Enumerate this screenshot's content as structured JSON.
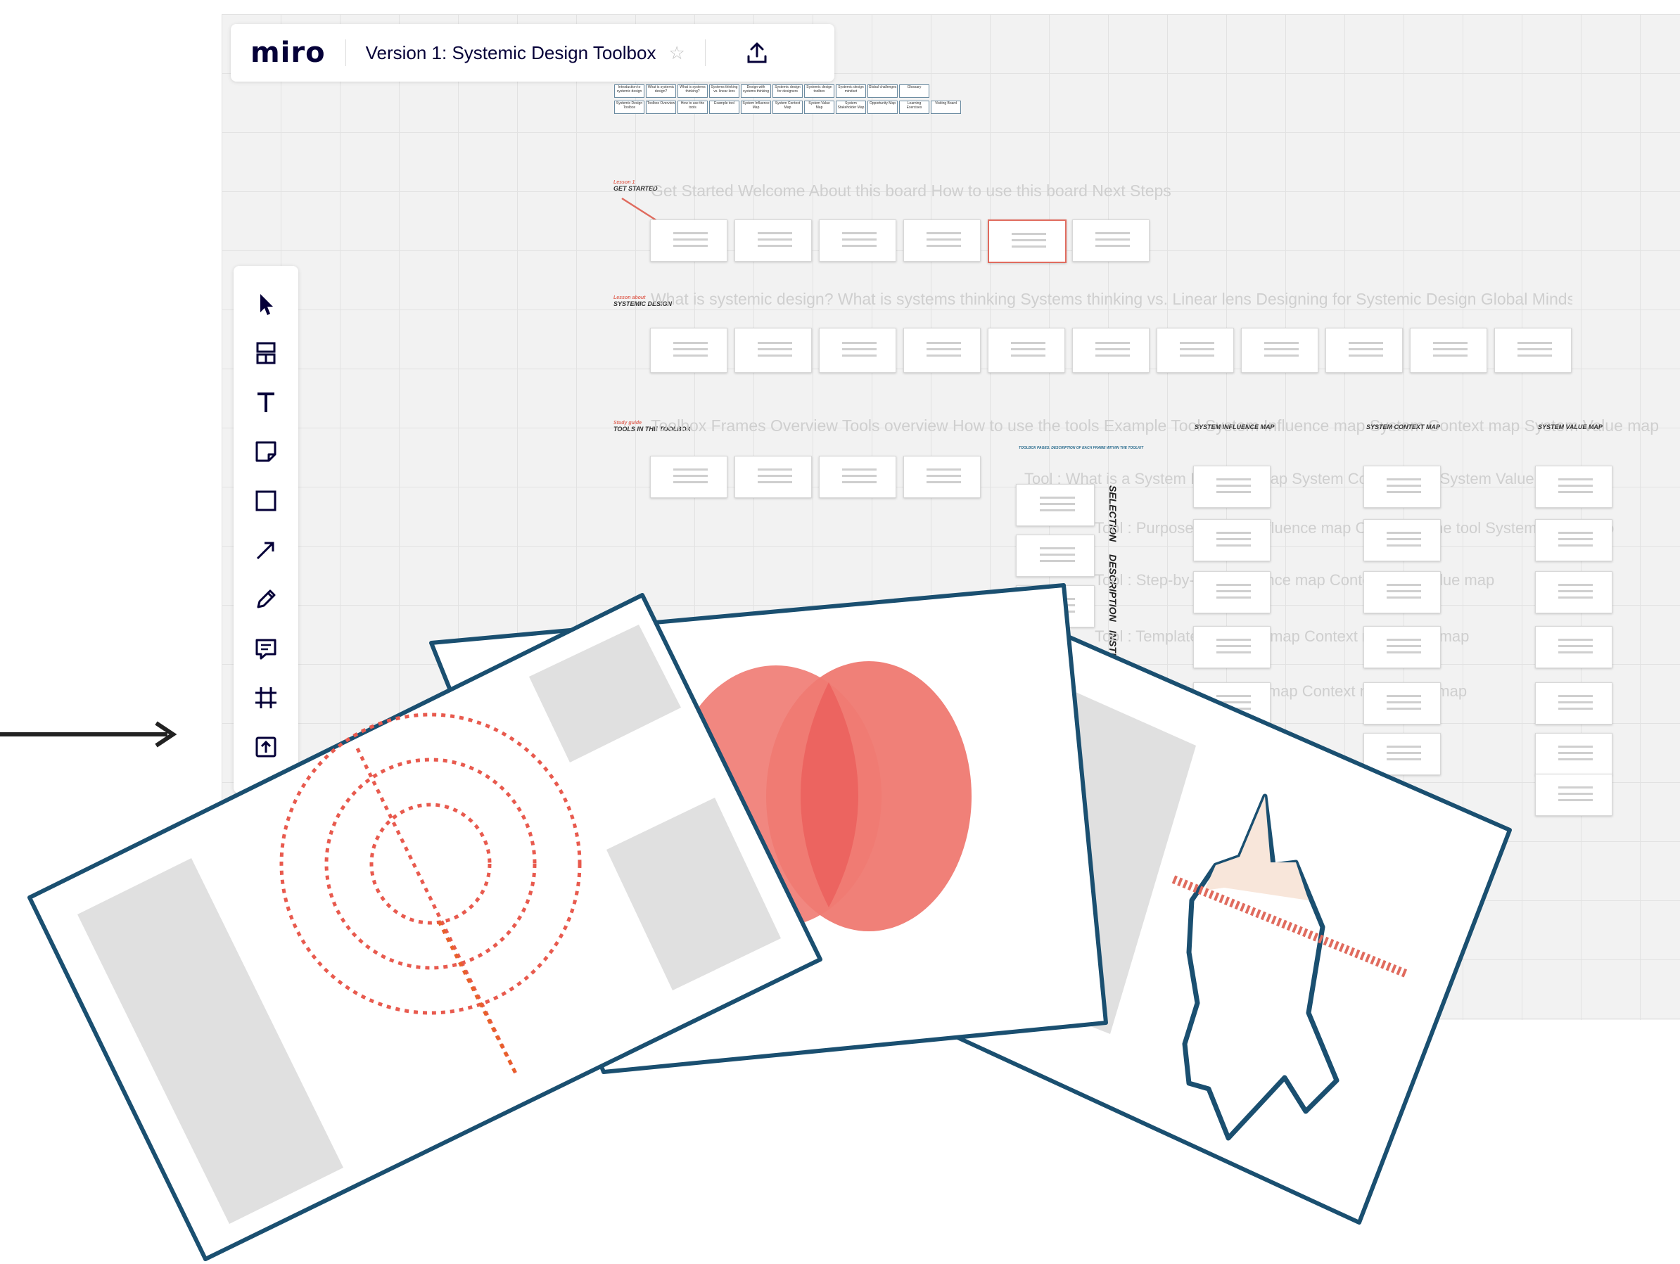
{
  "app": {
    "logo": "miro",
    "board_title": "Version 1: Systemic Design Toolbox"
  },
  "icons": {
    "star": "star-icon",
    "upload": "upload-icon",
    "tools": [
      "cursor-icon",
      "templates-icon",
      "text-icon",
      "sticky-note-icon",
      "rectangle-icon",
      "arrow-icon",
      "pen-icon",
      "comment-icon",
      "frame-icon",
      "upload-tool-icon"
    ]
  },
  "colors": {
    "accent": "#e06b5e",
    "brand": "#050038",
    "card_border": "#1a4f70",
    "coral": "#f07a70"
  },
  "nav_table": {
    "row1": [
      "Introduction to systemic design",
      "What is systemic design?",
      "What is systems thinking?",
      "Systems thinking vs. linear lens",
      "Design with systems thinking",
      "Systemic design for designers",
      "Systemic design toolbox",
      "Systemic design mindset",
      "Global challenges",
      "Glossary"
    ],
    "row2": [
      "Systemic Design Toolbox",
      "Toolbox Overview",
      "How to use the tools",
      "Example tool",
      "System Influence Map",
      "System Context Map",
      "System Value Map",
      "System Stakeholder Map",
      "Opportunity Map",
      "Learning Exercises",
      "Visiting Board"
    ]
  },
  "sections": [
    {
      "tag_small": "Lesson 1",
      "tag": "GET STARTED",
      "ghost": "Get Started Welcome  About this board  How to use this board  Next Steps"
    },
    {
      "tag_small": "Lesson about",
      "tag": "SYSTEMIC DESIGN",
      "ghost": "What is systemic design?  What is systems thinking  Systems thinking vs. Linear lens  Designing for Systemic Design  Global Mindsets  Glossary"
    },
    {
      "tag_small": "Study guide",
      "tag": "TOOLS IN THE TOOLBOX",
      "ghost": "Toolbox Frames Overview  Tools overview  How to use the tools  Example Tool  System Influence map  System Context map  System Value map"
    }
  ],
  "tool_columns": [
    "SYSTEM INFLUENCE MAP",
    "SYSTEM CONTEXT MAP",
    "SYSTEM VALUE MAP"
  ],
  "tool_header": "TOOLBOX PAGES: DESCRIPTION OF EACH FRAME WITHIN THE TOOLKIT",
  "row_labels": [
    "SELECTION",
    "DESCRIPTION",
    "INSTRUCTIONS"
  ],
  "ghost_rows": [
    "Tool : What is a System Influence map  System Context map  System Value map",
    "Tool : Purpose  System Influence map  Context of the tool  System Value map",
    "Tool : Step-by-step  Influence map  Context map  Value map",
    "Tool : Template  Influence map  Context map  Value map",
    "Tool : Example  Influence map  Context map  Value map"
  ]
}
